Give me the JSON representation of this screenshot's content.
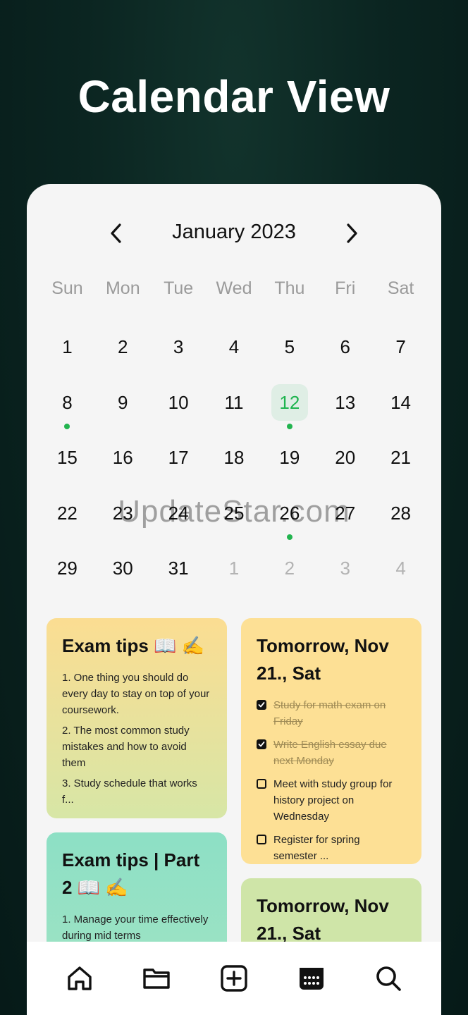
{
  "hero": {
    "title": "Calendar View"
  },
  "calendar": {
    "month_label": "January 2023",
    "weekdays": [
      "Sun",
      "Mon",
      "Tue",
      "Wed",
      "Thu",
      "Fri",
      "Sat"
    ],
    "weeks": [
      [
        {
          "d": "1"
        },
        {
          "d": "2"
        },
        {
          "d": "3"
        },
        {
          "d": "4"
        },
        {
          "d": "5"
        },
        {
          "d": "6"
        },
        {
          "d": "7"
        }
      ],
      [
        {
          "d": "8",
          "dot": true
        },
        {
          "d": "9"
        },
        {
          "d": "10"
        },
        {
          "d": "11"
        },
        {
          "d": "12",
          "today": true,
          "dot": true
        },
        {
          "d": "13"
        },
        {
          "d": "14"
        }
      ],
      [
        {
          "d": "15"
        },
        {
          "d": "16"
        },
        {
          "d": "17"
        },
        {
          "d": "18"
        },
        {
          "d": "19"
        },
        {
          "d": "20"
        },
        {
          "d": "21"
        }
      ],
      [
        {
          "d": "22"
        },
        {
          "d": "23"
        },
        {
          "d": "24"
        },
        {
          "d": "25"
        },
        {
          "d": "26",
          "dot": true
        },
        {
          "d": "27"
        },
        {
          "d": "28"
        }
      ],
      [
        {
          "d": "29"
        },
        {
          "d": "30"
        },
        {
          "d": "31"
        },
        {
          "d": "1",
          "muted": true
        },
        {
          "d": "2",
          "muted": true
        },
        {
          "d": "3",
          "muted": true
        },
        {
          "d": "4",
          "muted": true
        }
      ]
    ]
  },
  "watermark": "UpdateStar.com",
  "cards": {
    "exam1": {
      "title": "Exam tips 📖 ✍️",
      "items": [
        "1.  One thing you should do every day to stay on top of your coursework.",
        "2.  The most common study mistakes and how to avoid them",
        "3.  Study schedule that works f..."
      ]
    },
    "exam2": {
      "title": "Exam tips | Part 2 📖 ✍️",
      "items": [
        "1.  Manage your time effectively during mid terms"
      ]
    },
    "tomorrow1": {
      "title": "Tomorrow, Nov 21., Sat",
      "todos": [
        {
          "text": "Study for math exam on Friday",
          "done": true
        },
        {
          "text": "Write English essay due next Monday",
          "done": true
        },
        {
          "text": "Meet with study group for history project on Wednesday",
          "done": false
        },
        {
          "text": "Register for spring semester ...",
          "done": false
        }
      ]
    },
    "tomorrow2": {
      "title": "Tomorrow, Nov 21., Sat"
    }
  },
  "bottom_nav": [
    "home-icon",
    "folder-icon",
    "add-square-icon",
    "calendar-icon",
    "search-icon"
  ],
  "colors": {
    "accent": "#1fb44f",
    "today_bg": "#dfeee5",
    "dot": "#22b44f"
  }
}
